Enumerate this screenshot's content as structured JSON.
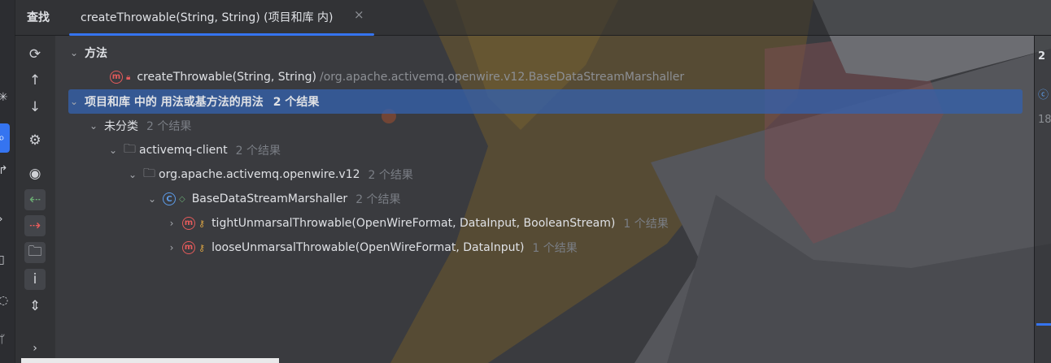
{
  "panel": {
    "title": "查找",
    "tab_label": "createThrowable(String, String) (项目和库 内)",
    "tab_close": "×"
  },
  "toolbar": {
    "icons": [
      "refresh-icon",
      "arrow-up-icon",
      "arrow-down-icon",
      "settings-icon",
      "eye-icon",
      "import-icon",
      "export-icon",
      "folder-star-icon",
      "info-icon",
      "expand-collapse-icon"
    ]
  },
  "tree": {
    "methods_header": "方法",
    "target_method": "createThrowable(String, String)",
    "target_path": "/org.apache.activemq.openwire.v12.BaseDataStreamMarshaller",
    "usages_header": "项目和库 中的 用法或基方法的用法",
    "usages_count": "2 个结果",
    "uncategorized": "未分类",
    "uncategorized_count": "2 个结果",
    "module": "activemq-client",
    "module_count": "2 个结果",
    "package": "org.apache.activemq.openwire.v12",
    "package_count": "2 个结果",
    "class_name": "BaseDataStreamMarshaller",
    "class_count": "2 个结果",
    "method1": "tightUnmarsalThrowable(OpenWireFormat, DataInput, BooleanStream)",
    "method1_count": "1 个结果",
    "method2": "looseUnmarsalThrowable(OpenWireFormat, DataInput)",
    "method2_count": "1 个结果"
  },
  "right_edge": {
    "texts": [
      "2",
      "18"
    ]
  },
  "colors": {
    "accent": "#3574f0",
    "selection": "#35609f",
    "method_icon": "#e55b5b",
    "class_icon": "#5c9be8"
  }
}
